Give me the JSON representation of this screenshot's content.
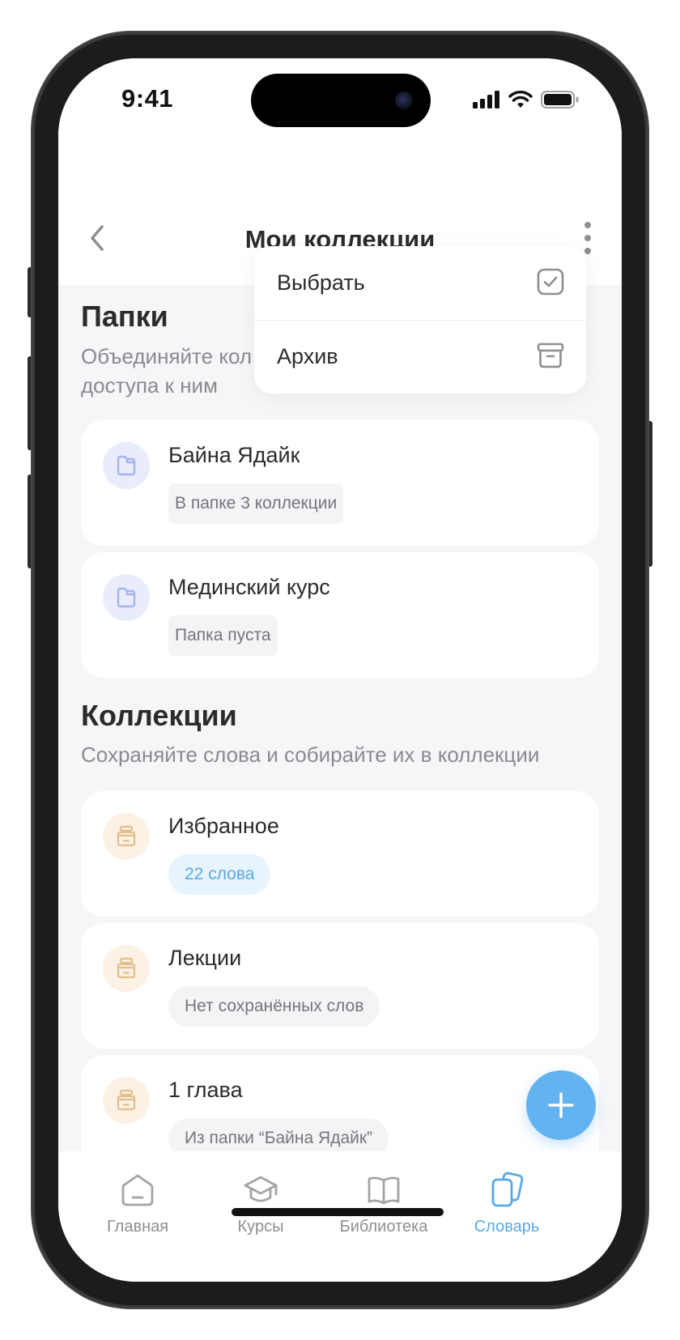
{
  "status_bar": {
    "time": "9:41"
  },
  "header": {
    "title": "Мои коллекции"
  },
  "folders": {
    "title": "Папки",
    "subtitle": "Объединяйте кол",
    "subtitle_line2": "доступа к ним",
    "items": [
      {
        "name": "Байна Ядайк",
        "meta": "В папке 3 коллекции"
      },
      {
        "name": "Мединский курс",
        "meta": "Папка пуста"
      }
    ]
  },
  "collections": {
    "title": "Коллекции",
    "subtitle": "Сохраняйте слова и собирайте их в коллекции",
    "items": [
      {
        "name": "Избранное",
        "meta": "22 слова"
      },
      {
        "name": "Лекции",
        "meta": "Нет сохранённых слов"
      },
      {
        "name": "1 глава",
        "meta": "Из папки “Байна Ядайк”"
      }
    ]
  },
  "menu": {
    "items": [
      {
        "label": "Выбрать",
        "icon": "checkbox-icon"
      },
      {
        "label": "Архив",
        "icon": "archive-icon"
      }
    ]
  },
  "tabbar": {
    "items": [
      {
        "label": "Главная",
        "icon": "home-icon"
      },
      {
        "label": "Курсы",
        "icon": "graduation-cap-icon"
      },
      {
        "label": "Библиотека",
        "icon": "book-icon"
      },
      {
        "label": "Словарь",
        "icon": "cards-icon",
        "active": true
      }
    ]
  },
  "colors": {
    "accent": "#63b3f0",
    "background": "#f6f6f8",
    "folder_icon": "#a5b4ef",
    "collection_icon": "#e3bf8c"
  }
}
